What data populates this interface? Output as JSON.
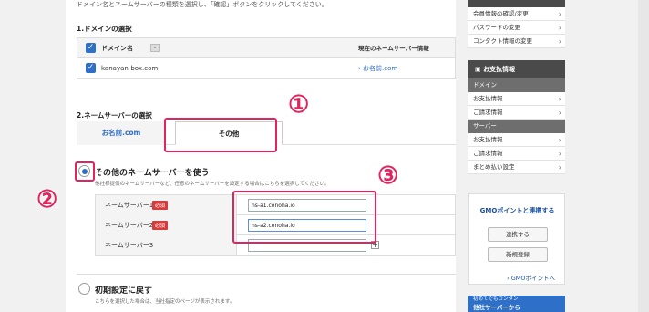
{
  "intro": "ドメイン名とネームサーバーの種類を選択し、「確認」ボタンをクリックしてください。",
  "domain_section": {
    "title": "1.ドメインの選択",
    "header_domain": "ドメイン名",
    "sort": "-",
    "header_current_ns": "現在のネームサーバー情報",
    "rows": [
      {
        "domain": "kanayan-box.com",
        "current_ns": "お名前.com"
      }
    ]
  },
  "ns_section": {
    "title": "2.ネームサーバーの選択",
    "tabs": [
      "お名前.com",
      "その他"
    ]
  },
  "other_option": {
    "title": "その他のネームサーバーを使う",
    "desc": "他社様提供のネームサーバーなど、任意のネームサーバーを設定する場合はこちらを選択してください。"
  },
  "ns_rows": [
    {
      "label": "ネームサーバー1",
      "required": "必須",
      "value": "ns-a1.conoha.io"
    },
    {
      "label": "ネームサーバー2",
      "required": "必須",
      "value": "ns-a2.conoha.io"
    },
    {
      "label": "ネームサーバー3",
      "required": "",
      "value": ""
    }
  ],
  "reset_option": {
    "title": "初期設定に戻す",
    "desc": "こちらを選択した場合は、当社指定のページが表示されます。"
  },
  "annotations": [
    "①",
    "②",
    "③"
  ],
  "sidebar": {
    "top_items": [
      "会員情報の確認/変更",
      "パスワードの変更",
      "コンタクト情報の変更"
    ],
    "payment_header": "お支払情報",
    "cat_domain": "ドメイン",
    "domain_items": [
      "お支払情報",
      "ご請求情報"
    ],
    "cat_server": "サーバー",
    "server_items": [
      "お支払情報",
      "ご請求情報",
      "まとめ払い設定"
    ],
    "gmo_title": "GMOポイントと連携する",
    "gmo_link_button": "連携する",
    "gmo_register_button": "新規登録",
    "gmo_points_link": "GMOポイントへ",
    "banner_line1": "初めてでもカンタン",
    "banner_line2": "他社サーバーから"
  },
  "colors": {
    "accent": "#2e6fc7",
    "annotation": "#e0245e",
    "required": "#d73c3c"
  }
}
